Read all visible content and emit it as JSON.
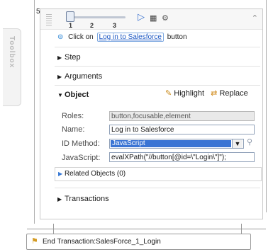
{
  "toolbox": {
    "label": "Toolbox"
  },
  "step": {
    "number": "5",
    "slider_ticks": [
      "1",
      "2",
      "3"
    ],
    "hint": {
      "prefix": "Click on",
      "link": "Log in to Salesforce",
      "suffix": "button"
    },
    "sections": {
      "step": "Step",
      "arguments": "Arguments",
      "object": "Object",
      "related": "Related Objects (0)",
      "transactions": "Transactions"
    },
    "object_actions": {
      "highlight": "Highlight",
      "replace": "Replace"
    },
    "fields": {
      "roles_label": "Roles:",
      "roles_value": "button,focusable,element",
      "name_label": "Name:",
      "name_value": "Log in to Salesforce",
      "id_method_label": "ID Method:",
      "id_method_value": "JavaScript",
      "javascript_label": "JavaScript:",
      "javascript_value": "evalXPath(\"//button[@id=\\\"Login\\\"]\");"
    }
  },
  "end_transaction": {
    "label": "End Transaction:SalesForce_1_Login"
  },
  "colors": {
    "link": "#1a56c3",
    "select_highlight": "#3a74d4",
    "info_icon": "#2c86d5"
  }
}
